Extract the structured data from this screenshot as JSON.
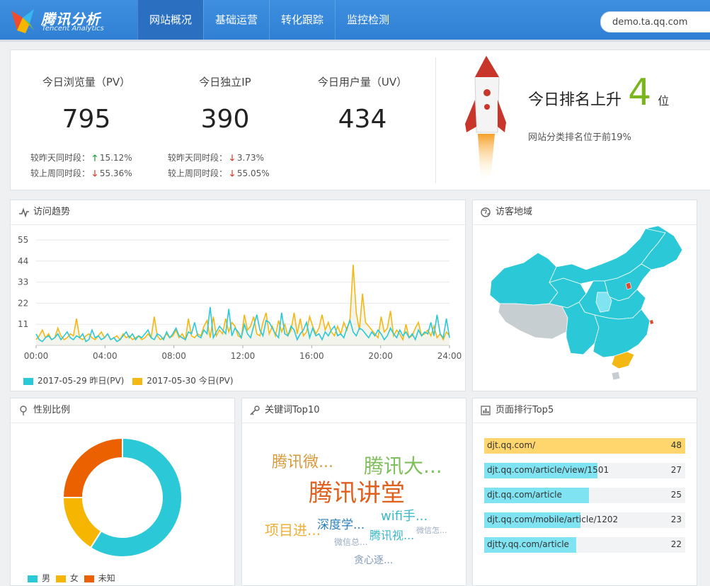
{
  "header": {
    "logo_cn": "腾讯分析",
    "logo_en": "Tencent Analytics",
    "tabs": [
      {
        "label": "网站概况",
        "active": true
      },
      {
        "label": "基础运营",
        "active": false
      },
      {
        "label": "转化跟踪",
        "active": false
      },
      {
        "label": "监控检测",
        "active": false
      }
    ],
    "domain": "demo.ta.qq.com"
  },
  "summary": {
    "stats": [
      {
        "label": "今日浏览量（PV）",
        "value": "795",
        "day_label": "较昨天同时段：",
        "day_dir": "up",
        "day_pct": "15.12%",
        "week_label": "较上周同时段：",
        "week_dir": "down",
        "week_pct": "55.36%"
      },
      {
        "label": "今日独立IP",
        "value": "390",
        "day_label": "较昨天同时段：",
        "day_dir": "down",
        "day_pct": "3.73%",
        "week_label": "较上周同时段：",
        "week_dir": "down",
        "week_pct": "55.05%"
      },
      {
        "label": "今日用户量（UV）",
        "value": "434"
      }
    ],
    "rank": {
      "prefix": "今日排名上升",
      "number": "4",
      "unit": "位",
      "sub": "网站分类排名位于前19%"
    }
  },
  "trend": {
    "title": "访问趋势",
    "colors": {
      "yesterday": "#2bc8d8",
      "today": "#f4b815"
    },
    "chart_data": {
      "type": "line",
      "x_ticks": [
        "00:00",
        "04:00",
        "08:00",
        "12:00",
        "16:00",
        "20:00",
        "24:00"
      ],
      "y_ticks": [
        55,
        44,
        33,
        22,
        11
      ],
      "ylim": [
        0,
        55
      ],
      "legend_position": "bottom-left",
      "series": [
        {
          "name": "2017-05-29 昨日(PV)",
          "color": "#2bc8d8",
          "values": [
            6,
            3,
            2,
            4,
            5,
            3,
            4,
            6,
            3,
            5,
            7,
            4,
            3,
            5,
            4,
            6,
            2,
            3,
            8,
            4,
            5,
            3,
            4,
            6,
            3,
            4,
            2,
            3,
            5,
            7,
            4,
            6,
            3,
            5,
            4,
            6,
            8,
            4,
            3,
            6,
            5,
            3,
            7,
            4,
            6,
            9,
            5,
            4,
            3,
            7,
            6,
            12,
            5,
            4,
            8,
            6,
            20,
            4,
            7,
            10,
            8,
            6,
            19,
            5,
            9,
            7,
            4,
            11,
            6,
            4,
            10,
            16,
            8,
            5,
            13,
            12,
            9,
            6,
            4,
            17,
            6,
            5,
            10,
            8,
            3,
            6,
            8,
            12,
            4,
            9,
            5,
            6,
            3,
            7,
            5,
            8,
            10,
            5,
            6,
            4,
            9,
            13,
            7,
            5,
            9,
            8,
            6,
            4,
            7,
            5,
            8,
            6,
            3,
            5,
            9,
            6,
            4,
            8,
            5,
            7,
            4,
            6,
            3,
            8,
            5,
            7,
            6,
            12,
            5,
            16,
            6,
            4,
            14,
            4
          ]
        },
        {
          "name": "2017-05-30 今日(PV)",
          "color": "#f4b815",
          "values": [
            3,
            5,
            8,
            4,
            6,
            3,
            4,
            9,
            5,
            3,
            4,
            6,
            5,
            14,
            4,
            3,
            5,
            6,
            4,
            3,
            5,
            7,
            4,
            6,
            3,
            4,
            5,
            3,
            6,
            4,
            5,
            3,
            4,
            5,
            3,
            4,
            6,
            4,
            15,
            5,
            3,
            4,
            6,
            4,
            5,
            8,
            4,
            6,
            3,
            14,
            5,
            4,
            6,
            5,
            10,
            13,
            4,
            15,
            5,
            8,
            6,
            14,
            7,
            12,
            10,
            5,
            4,
            16,
            8,
            10,
            15,
            6,
            5,
            12,
            17,
            6,
            10,
            5,
            13,
            7,
            11,
            5,
            8,
            17,
            6,
            14,
            5,
            7,
            15,
            10,
            6,
            9,
            16,
            8,
            12,
            7,
            5,
            10,
            6,
            12,
            8,
            14,
            42,
            17,
            8,
            27,
            12,
            10,
            8,
            6,
            4,
            15,
            7,
            9,
            18,
            5,
            8,
            6,
            3,
            11,
            4,
            5,
            9,
            12,
            5,
            6,
            8,
            5,
            10,
            4,
            6,
            3,
            7,
            5
          ]
        }
      ]
    }
  },
  "region": {
    "title": "访客地域"
  },
  "gender": {
    "title": "性别比例",
    "chart_data": {
      "type": "pie",
      "legend_position": "bottom-left",
      "slices": [
        {
          "label": "男",
          "value": 59,
          "color": "#2bc8d8"
        },
        {
          "label": "女",
          "value": 16,
          "color": "#f6b500"
        },
        {
          "label": "未知",
          "value": 25,
          "color": "#eb6100"
        }
      ]
    }
  },
  "keywords": {
    "title": "关键词Top10",
    "words": [
      {
        "text": "腾讯微...",
        "color": "#d69b3c",
        "size": 22
      },
      {
        "text": "腾讯大...",
        "color": "#7fbf5b",
        "size": 28
      },
      {
        "text": "腾讯讲堂",
        "color": "#e0601e",
        "size": 34
      },
      {
        "text": "wifi手...",
        "color": "#3ab9c9",
        "size": 18
      },
      {
        "text": "项目进...",
        "color": "#f0b03a",
        "size": 20
      },
      {
        "text": "深度学...",
        "color": "#2b7fbf",
        "size": 17
      },
      {
        "text": "腾讯视...",
        "color": "#3ab9c9",
        "size": 16
      },
      {
        "text": "微信怎...",
        "color": "#9aaec0",
        "size": 11
      },
      {
        "text": "微信总...",
        "color": "#9aaec0",
        "size": 12
      },
      {
        "text": "贪心逐...",
        "color": "#7e9ab5",
        "size": 14
      }
    ]
  },
  "pages": {
    "title": "页面排行Top5",
    "chart_data": {
      "type": "bar",
      "orientation": "horizontal",
      "categories": [
        "djt.qq.com/",
        "djt.qq.com/article/view/1501",
        "djt.qq.com/article",
        "djt.qq.com/mobile/article/1202",
        "djtty.qq.com/article"
      ],
      "values": [
        48,
        27,
        25,
        23,
        22
      ],
      "xlim": [
        0,
        48
      ],
      "colors": [
        "#ffd66e",
        "#7fe3f2",
        "#7fe3f2",
        "#7fe3f2",
        "#7fe3f2"
      ]
    }
  }
}
